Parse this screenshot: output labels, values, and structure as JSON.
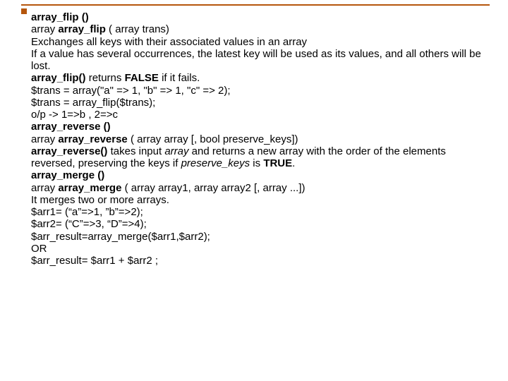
{
  "lines": {
    "l1a": "array_flip ()",
    "l2_pre": "array ",
    "l2_b": "array_flip",
    "l2_post": " ( array trans)",
    "l3": "Exchanges all keys with their associated values in an array",
    "l4": "If a value has several occurrences, the latest key will be used as its values, and all others will be lost.",
    "l5_b1": "array_flip()",
    "l5_mid": " returns ",
    "l5_b2": "FALSE",
    "l5_post": " if it fails.",
    "l6": "$trans = array(\"a\" => 1, \"b\" => 1, \"c\" => 2);",
    "l7": "$trans = array_flip($trans);",
    "l8": "o/p ->  1=>b , 2=>c",
    "l9": "array_reverse ()",
    "l10_pre": "array ",
    "l10_b": "array_reverse",
    "l10_post": " ( array array [, bool preserve_keys])",
    "l11_b": "array_reverse()",
    "l11_mid1": " takes input ",
    "l11_i1": "array",
    "l11_mid2": " and returns a new array with the order of the elements reversed, preserving the keys if ",
    "l11_i2": "preserve_keys",
    "l11_mid3": " is ",
    "l11_b2": "TRUE",
    "l11_post": ".",
    "l12": "array_merge ()",
    "l13_pre": "array ",
    "l13_b": "array_merge",
    "l13_post": " ( array array1, array array2 [, array ...])",
    "l14": "  It merges two or more arrays.",
    "l15": "$arr1= (“a”=>1, ”b”=>2);",
    "l16": "$arr2= (“C”=>3, “D”=>4);",
    "l17": "$arr_result=array_merge($arr1,$arr2);",
    "l18": "OR",
    "l19": "$arr_result= $arr1 + $arr2  ;"
  }
}
